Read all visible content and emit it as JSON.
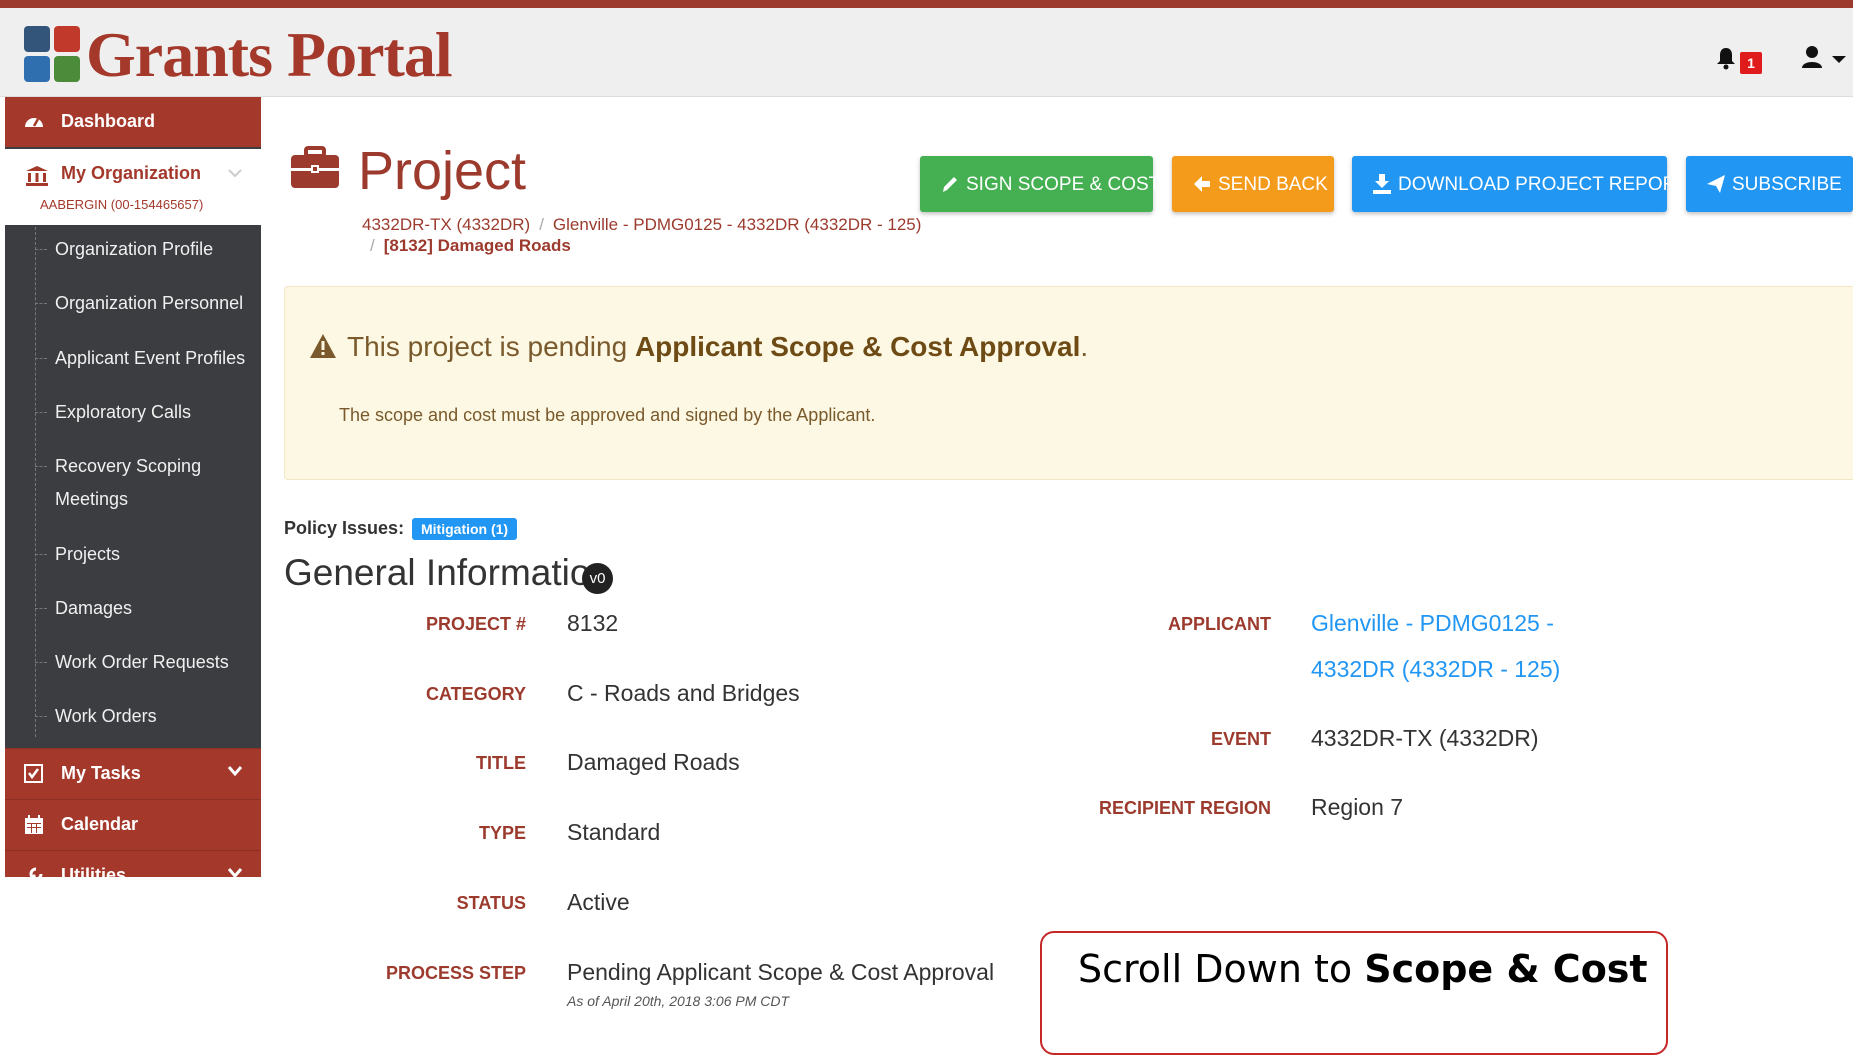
{
  "header": {
    "logo_text": "Grants Portal",
    "notification_count": "1"
  },
  "sidebar": {
    "dashboard": "Dashboard",
    "my_org": {
      "title": "My Organization",
      "subtitle": "AABERGIN (00-154465657)"
    },
    "items": [
      "Organization Profile",
      "Organization Personnel",
      "Applicant Event Profiles",
      "Exploratory Calls",
      "Recovery Scoping Meetings",
      "Projects",
      "Damages",
      "Work Order Requests",
      "Work Orders"
    ],
    "my_tasks": "My Tasks",
    "calendar": "Calendar",
    "utilities": "Utilities"
  },
  "page": {
    "title": "Project",
    "breadcrumb": [
      "4332DR-TX (4332DR)",
      "Glenville - PDMG0125 - 4332DR (4332DR - 125)",
      "[8132] Damaged Roads"
    ]
  },
  "actions": {
    "sign": "SIGN SCOPE & COST",
    "send_back": "SEND BACK",
    "download": "DOWNLOAD PROJECT REPORT",
    "subscribe": "SUBSCRIBE"
  },
  "alert": {
    "prefix": "This project is pending ",
    "bold": "Applicant Scope & Cost Approval",
    "suffix": ".",
    "detail": "The scope and cost must be approved and signed by the Applicant."
  },
  "policy": {
    "label": "Policy Issues:",
    "badge": "Mitigation  (1)"
  },
  "general": {
    "title": "General Information",
    "version": "v0",
    "left_fields": [
      {
        "label": "PROJECT #",
        "value": "8132"
      },
      {
        "label": "CATEGORY",
        "value": "C - Roads and Bridges"
      },
      {
        "label": "TITLE",
        "value": "Damaged Roads"
      },
      {
        "label": "TYPE",
        "value": "Standard"
      },
      {
        "label": "STATUS",
        "value": "Active"
      },
      {
        "label": "PROCESS STEP",
        "value": "Pending Applicant Scope & Cost Approval"
      }
    ],
    "process_step_asof": "As of April 20th, 2018 3:06 PM CDT",
    "applicant": {
      "label": "APPLICANT",
      "line1": "Glenville - PDMG0125 -",
      "line2": "4332DR (4332DR - 125)"
    },
    "event": {
      "label": "EVENT",
      "value": "4332DR-TX (4332DR)"
    },
    "region": {
      "label": "RECIPIENT REGION",
      "value": "Region 7"
    }
  },
  "callout": {
    "prefix": "Scroll Down to ",
    "bold": "Scope & Cost"
  },
  "colors": {
    "brand": "#a3382b",
    "sidebar_bg": "#3b3d40",
    "success": "#45b052",
    "warning": "#f59b1b",
    "primary": "#2196f3",
    "alert_bg": "#fcf8e3"
  }
}
